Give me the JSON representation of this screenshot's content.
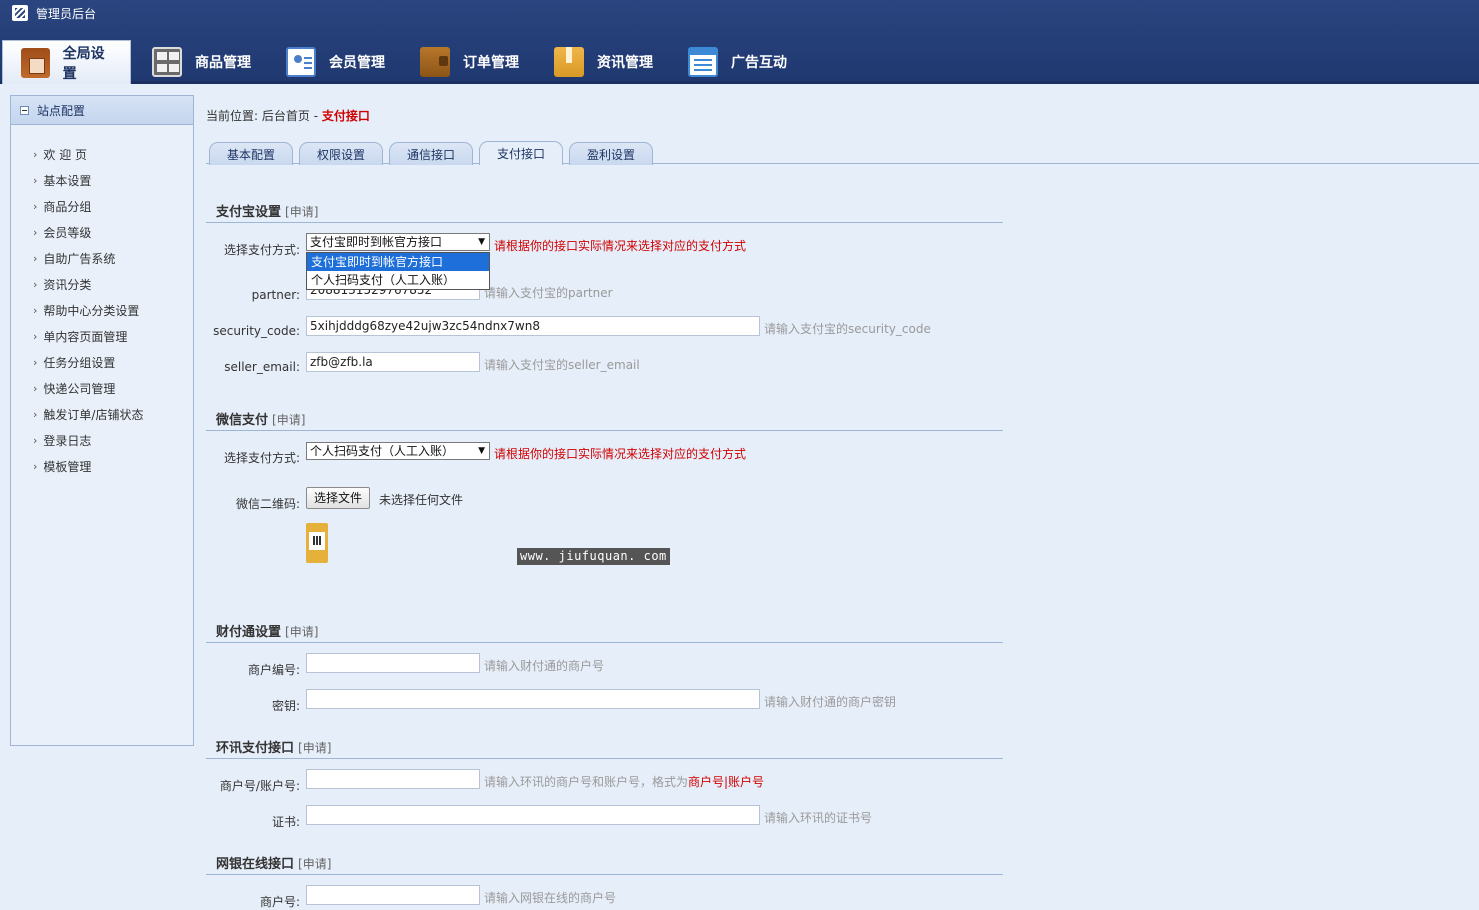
{
  "header": {
    "brand": "管理员后台",
    "nav": [
      {
        "label": "全局设置",
        "icon": "settings-box-icon",
        "active": true
      },
      {
        "label": "商品管理",
        "icon": "grid-icon"
      },
      {
        "label": "会员管理",
        "icon": "member-card-icon"
      },
      {
        "label": "订单管理",
        "icon": "wallet-icon"
      },
      {
        "label": "资讯管理",
        "icon": "news-icon"
      },
      {
        "label": "广告互动",
        "icon": "ad-list-icon"
      }
    ]
  },
  "sidebar": {
    "title": "站点配置",
    "items": [
      {
        "label": "欢 迎 页"
      },
      {
        "label": "基本设置"
      },
      {
        "label": "商品分组"
      },
      {
        "label": "会员等级"
      },
      {
        "label": "自助广告系统"
      },
      {
        "label": "资讯分类"
      },
      {
        "label": "帮助中心分类设置"
      },
      {
        "label": "单内容页面管理"
      },
      {
        "label": "任务分组设置"
      },
      {
        "label": "快递公司管理"
      },
      {
        "label": "触发订单/店铺状态"
      },
      {
        "label": "登录日志"
      },
      {
        "label": "模板管理"
      }
    ]
  },
  "breadcrumb": {
    "prefix": "当前位置:",
    "home": "后台首页",
    "sep": "-",
    "current": "支付接口"
  },
  "tabs": [
    {
      "label": "基本配置"
    },
    {
      "label": "权限设置"
    },
    {
      "label": "通信接口"
    },
    {
      "label": "支付接口",
      "active": true
    },
    {
      "label": "盈利设置"
    }
  ],
  "apply_label": "[申请]",
  "alipay": {
    "title": "支付宝设置",
    "method_label": "选择支付方式:",
    "method_value": "支付宝即时到帐官方接口",
    "method_warning": "请根据你的接口实际情况来选择对应的支付方式",
    "options": [
      "支付宝即时到帐官方接口",
      "个人扫码支付（人工入账）"
    ],
    "partner_label": "partner:",
    "partner_value": "2088131529767852",
    "partner_hint": "请输入支付宝的partner",
    "security_label": "security_code:",
    "security_value": "5xihjdddg68zye42ujw3zc54ndnx7wn8",
    "security_hint": "请输入支付宝的security_code",
    "email_label": "seller_email:",
    "email_value": "zfb@zfb.la",
    "email_hint": "请输入支付宝的seller_email"
  },
  "wechat": {
    "title": "微信支付",
    "method_label": "选择支付方式:",
    "method_value": "个人扫码支付（人工入账）",
    "method_warning": "请根据你的接口实际情况来选择对应的支付方式",
    "qr_label": "微信二维码:",
    "file_button": "选择文件",
    "no_file": "未选择任何文件"
  },
  "watermark": "www. jiufuquan. com",
  "tenpay": {
    "title": "财付通设置",
    "merchant_label": "商户编号:",
    "merchant_hint": "请输入财付通的商户号",
    "key_label": "密钥:",
    "key_hint": "请输入财付通的商户密钥"
  },
  "ips": {
    "title": "环讯支付接口",
    "account_label": "商户号/账户号:",
    "account_hint": "请输入环讯的商户号和账户号，格式为",
    "account_format": "商户号|账户号",
    "cert_label": "证书:",
    "cert_hint": "请输入环讯的证书号"
  },
  "chinabank": {
    "title": "网银在线接口",
    "merchant_label": "商户号:",
    "merchant_hint": "请输入网银在线的商户号"
  }
}
